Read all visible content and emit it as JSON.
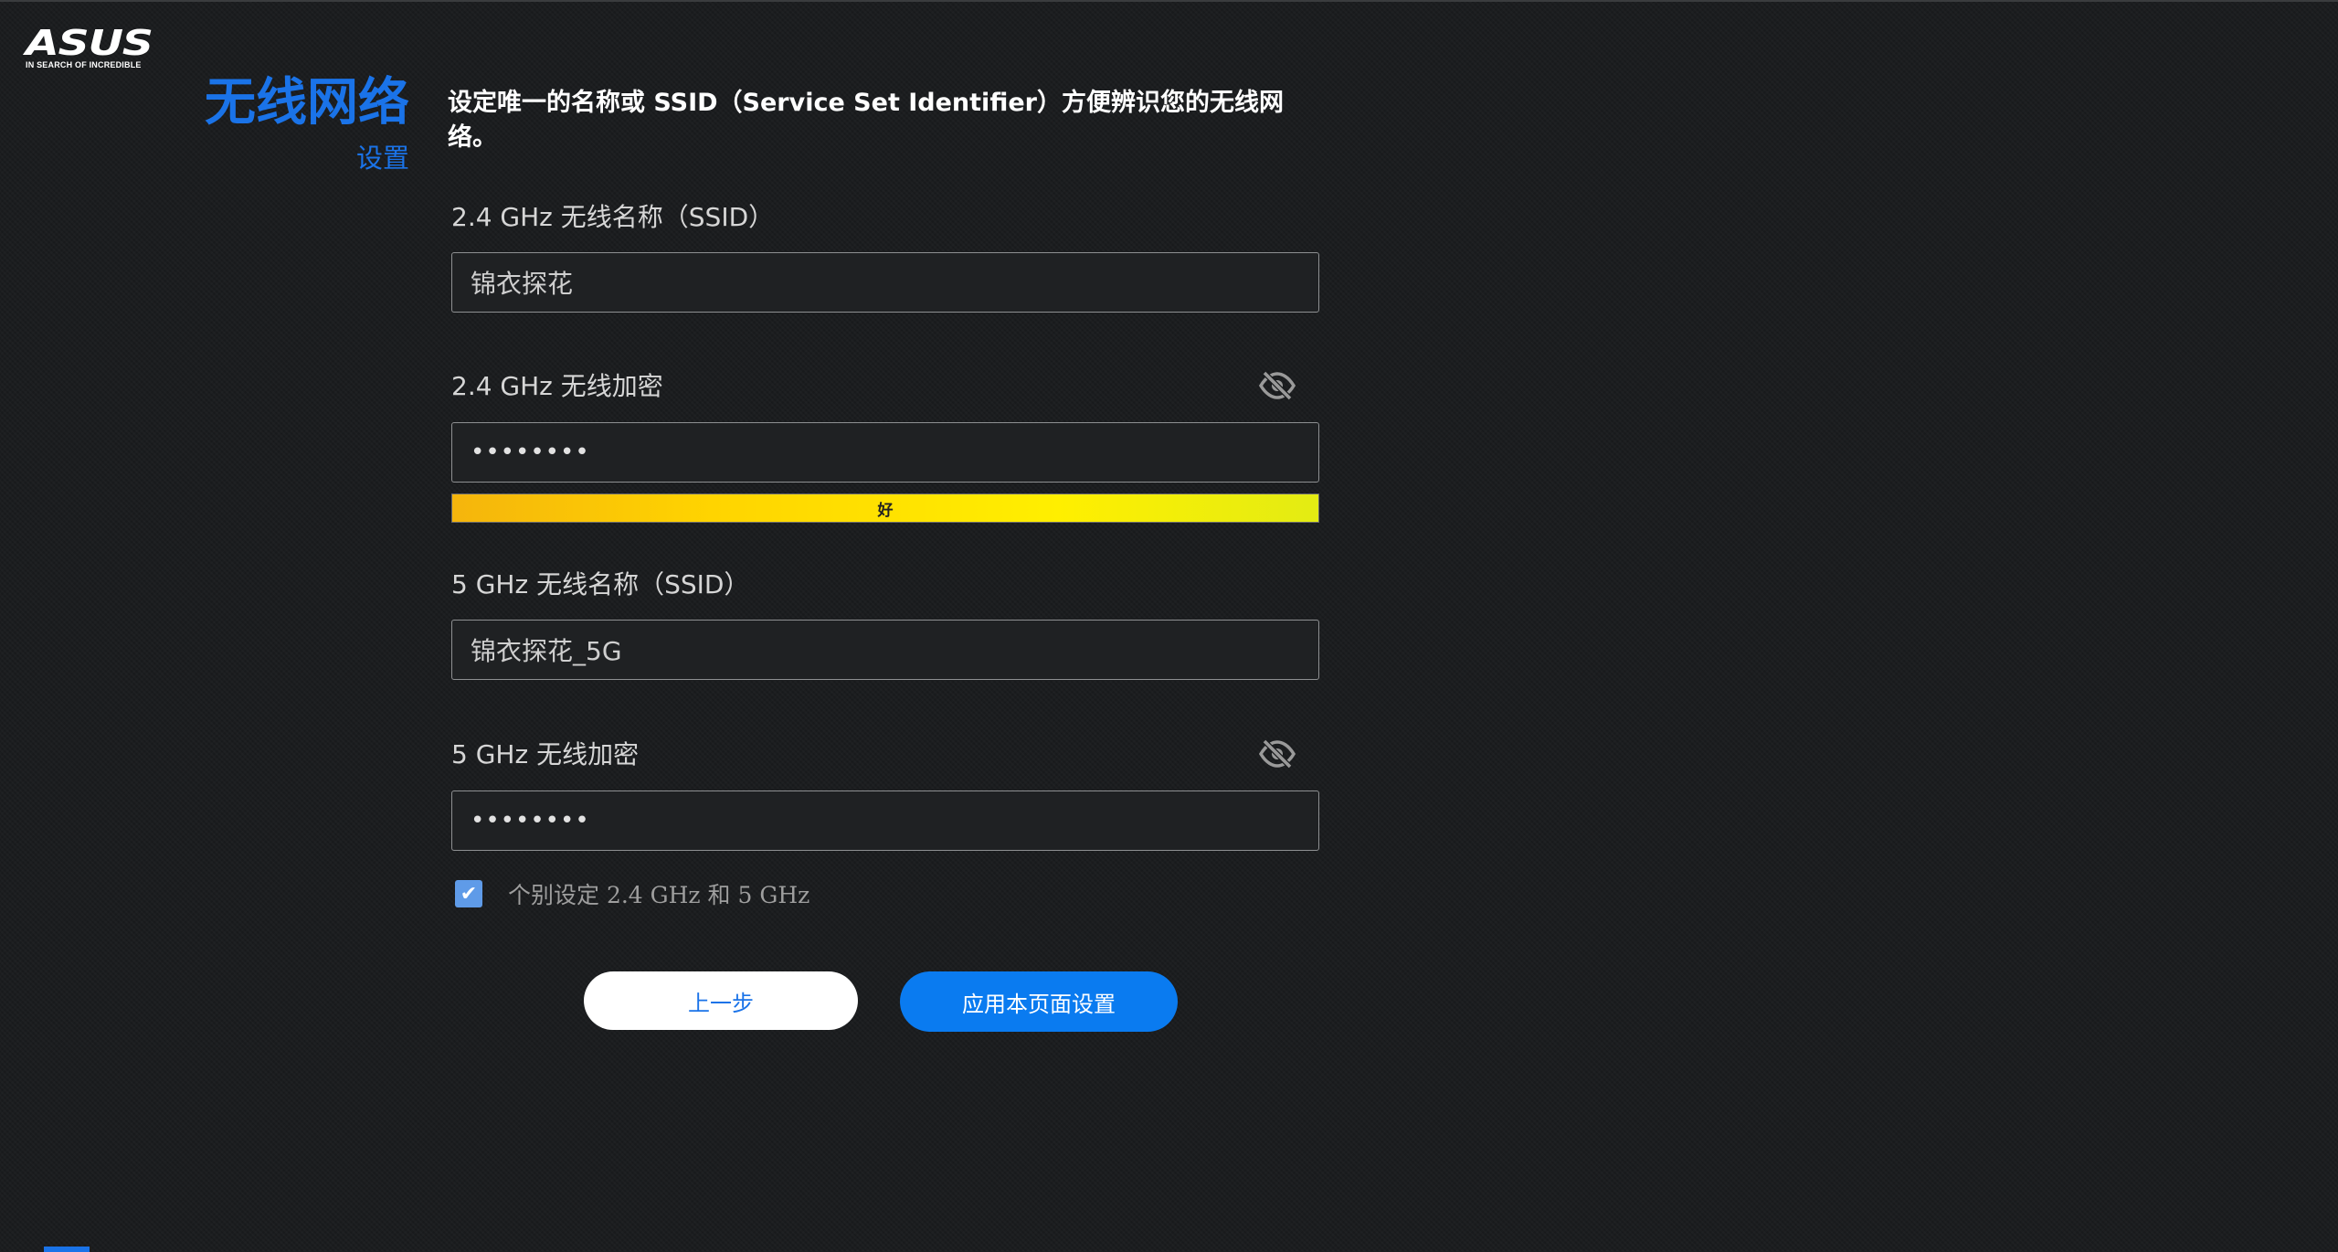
{
  "brand": {
    "logo_text": "ASUS",
    "tagline": "IN SEARCH OF INCREDIBLE"
  },
  "sidebar": {
    "title": "无线网络",
    "subtitle": "设置"
  },
  "description": "设定唯一的名称或 SSID（Service Set Identifier）方便辨识您的无线网络。",
  "fields": {
    "ssid_24": {
      "label": "2.4 GHz 无线名称（SSID）",
      "value": "锦衣探花"
    },
    "password_24": {
      "label": "2.4 GHz 无线加密",
      "value": "••••••••",
      "strength_label": "好",
      "icon": "eye-slash-icon"
    },
    "ssid_5": {
      "label": "5 GHz 无线名称（SSID）",
      "value": "锦衣探花_5G"
    },
    "password_5": {
      "label": "5 GHz 无线加密",
      "value": "••••••••",
      "icon": "eye-slash-icon"
    }
  },
  "separate_setting": {
    "label": "个别设定 2.4 GHz 和 5 GHz",
    "checked": true
  },
  "buttons": {
    "back": "上一步",
    "apply": "应用本页面设置"
  },
  "colors": {
    "accent": "#1a73e8",
    "button_blue": "#0a7bf0",
    "background": "#1b1d1f"
  }
}
